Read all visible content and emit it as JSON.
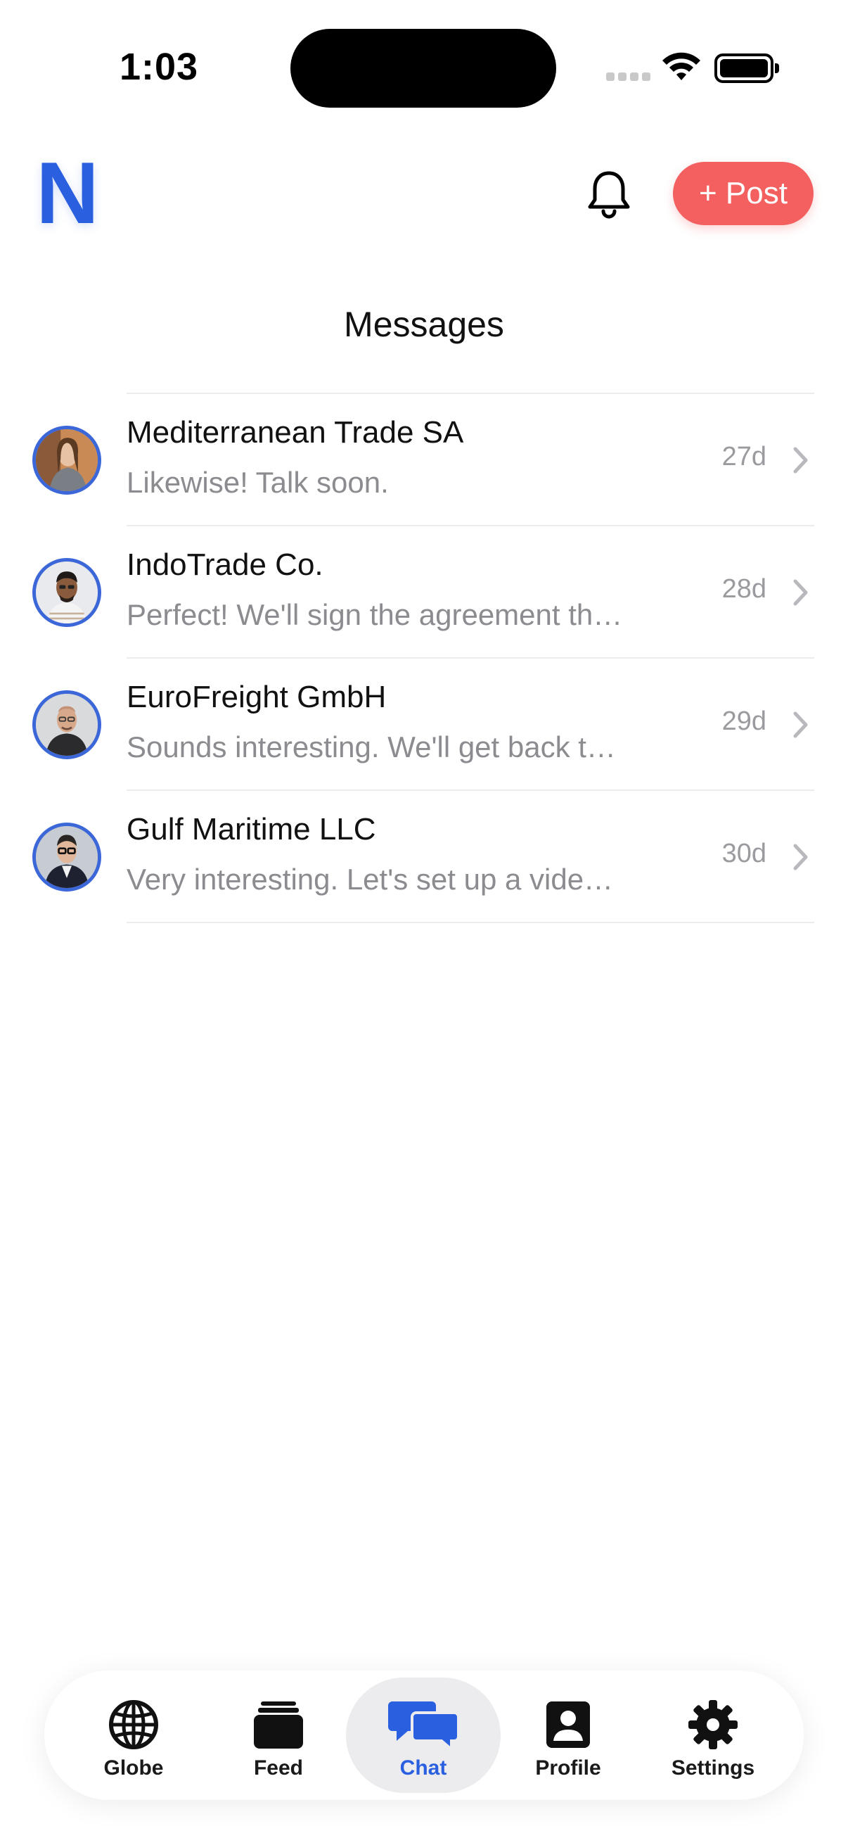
{
  "status_bar": {
    "time": "1:03"
  },
  "header": {
    "logo_letter": "N",
    "post_button_label": "+ Post",
    "title": "Messages"
  },
  "messages": [
    {
      "name": "Mediterranean Trade SA",
      "preview": "Likewise! Talk soon.",
      "time": "27d"
    },
    {
      "name": "IndoTrade Co.",
      "preview": "Perfect! We'll sign the agreement th…",
      "time": "28d"
    },
    {
      "name": "EuroFreight GmbH",
      "preview": "Sounds interesting. We'll get back t…",
      "time": "29d"
    },
    {
      "name": "Gulf Maritime LLC",
      "preview": "Very interesting. Let's set up a vide…",
      "time": "30d"
    }
  ],
  "tabs": [
    {
      "label": "Globe",
      "icon": "globe-icon"
    },
    {
      "label": "Feed",
      "icon": "feed-icon"
    },
    {
      "label": "Chat",
      "icon": "chat-icon",
      "active": true
    },
    {
      "label": "Profile",
      "icon": "profile-icon"
    },
    {
      "label": "Settings",
      "icon": "gear-icon"
    }
  ],
  "colors": {
    "accent": "#2a5fe0",
    "post_button": "#f4605f",
    "muted_text": "#8b8b90"
  }
}
